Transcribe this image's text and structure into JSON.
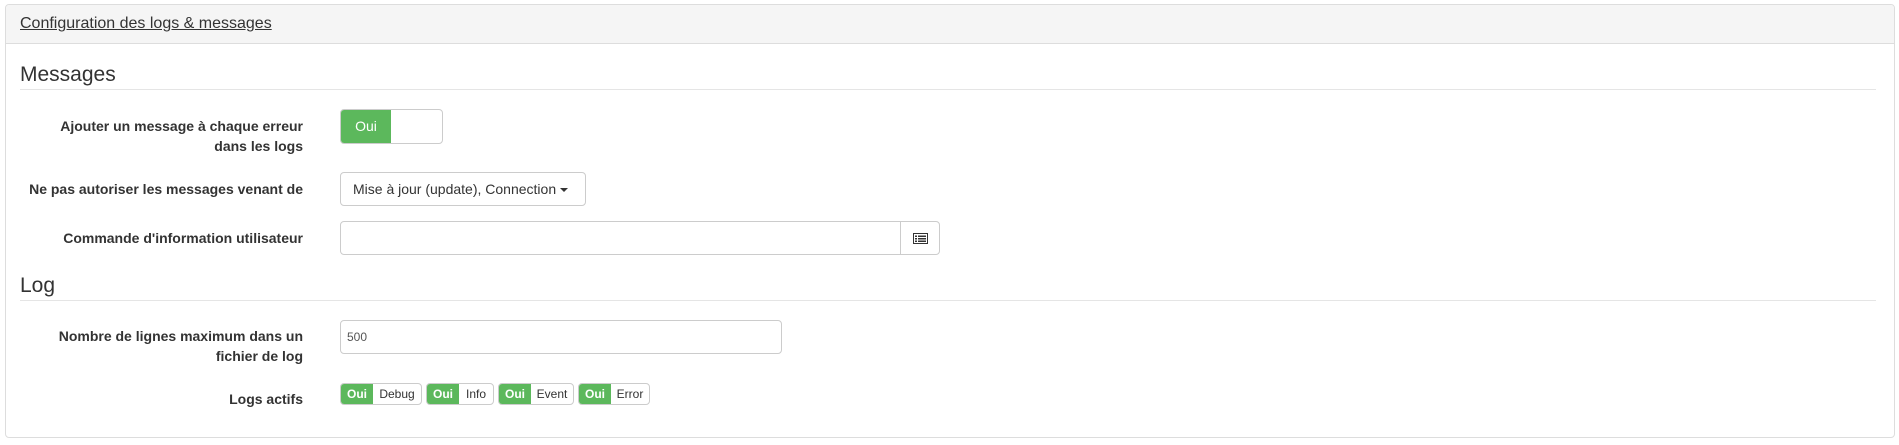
{
  "panel": {
    "title": "Configuration des logs & messages"
  },
  "messages": {
    "legend": "Messages",
    "error_message": {
      "label_line1": "Ajouter un message à chaque erreur",
      "label_line2": "dans les logs",
      "toggle_on": "Oui"
    },
    "block_messages": {
      "label": "Ne pas autoriser les messages venant de",
      "selected": "Mise à jour (update), Connection"
    },
    "user_info_command": {
      "label": "Commande d'information utilisateur",
      "value": "",
      "button_icon": "list-alt-icon"
    }
  },
  "log": {
    "legend": "Log",
    "max_lines": {
      "label_line1": "Nombre de lignes maximum dans un",
      "label_line2": "fichier de log",
      "value": "500"
    },
    "active_logs": {
      "label": "Logs actifs",
      "toggles": [
        {
          "on": "Oui",
          "name": "Debug"
        },
        {
          "on": "Oui",
          "name": "Info"
        },
        {
          "on": "Oui",
          "name": "Event"
        },
        {
          "on": "Oui",
          "name": "Error"
        }
      ]
    }
  },
  "colors": {
    "success": "#5cb85c",
    "border": "#cccccc",
    "heading_bg": "#f5f5f5"
  }
}
